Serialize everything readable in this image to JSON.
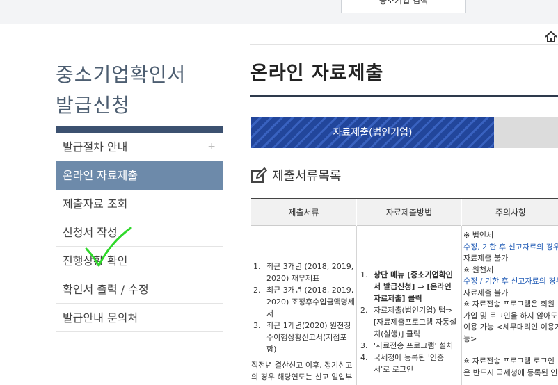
{
  "header": {
    "top_button_label": "중소기업 검색"
  },
  "sidebar": {
    "title_line1": "중소기업확인서",
    "title_line2": "발급신청",
    "items": [
      {
        "label": "발급절차 안내",
        "plus": "+"
      },
      {
        "label": "온라인 자료제출"
      },
      {
        "label": "제출자료 조회"
      },
      {
        "label": "신청서 작성"
      },
      {
        "label": "진행상황 확인"
      },
      {
        "label": "확인서 출력 / 수정"
      },
      {
        "label": "발급안내 문의처"
      }
    ]
  },
  "main": {
    "page_title": "온라인 자료제출",
    "tabs": [
      {
        "label": "자료제출(법인기업)"
      },
      {
        "label": ""
      }
    ],
    "section_title": "제출서류목록",
    "table": {
      "headers": [
        "제출서류",
        "자료제출방법",
        "주의사항"
      ],
      "col1_items": [
        {
          "num": "1.",
          "text": "최근 3개년 (2018, 2019, 2020) 재무제표"
        },
        {
          "num": "2.",
          "text": "최근 3개년 (2018, 2019, 2020) 조정후수입금액명세서"
        },
        {
          "num": "3.",
          "text": "최근 1개년(2020) 원천징수이행상황신고서(지점포함)"
        }
      ],
      "col1_tail": "직전년 결산신고 이후, 정기신고의 경우 해당연도는 신고 일입부",
      "col2_items": [
        {
          "num": "1.",
          "text": "상단 메뉴 [중소기업확인서 발급신청] ⇒ [온라인 자료제출] 클릭"
        },
        {
          "num": "2.",
          "text": "자료제출(법인기업) 탭⇒ [자료제출프로그램 자동설치(실행)] 클릭"
        },
        {
          "num": "3.",
          "text": "'자료전송 프로그램' 설치"
        },
        {
          "num": "4.",
          "text": "국세청에 등록된 '인증서'로 로그인"
        }
      ],
      "col3_lines": [
        {
          "text": "※ 법인세",
          "blue": false
        },
        {
          "text": "수정, 기한 후 신고자료의 경우",
          "blue": true
        },
        {
          "text": "자료제출 불가",
          "blue": false
        },
        {
          "text": "※ 원천세",
          "blue": false
        },
        {
          "text": "수정 / 기한 후 신고자료의 경우",
          "blue": true
        },
        {
          "text": "자료제출 불가",
          "blue": false
        },
        {
          "text": "※ 자료전송 프로그램은 회원",
          "blue": false
        },
        {
          "text": "가입 및 로그인을 하지 않아도",
          "blue": false
        },
        {
          "text": "이용 가능 <세무대리인 이용가",
          "blue": false
        },
        {
          "text": "능>",
          "blue": false
        },
        {
          "text": "",
          "blue": false
        },
        {
          "text": "※ 자료전송 프로그램 로그인",
          "blue": false
        },
        {
          "text": "은 반드시 국세청에 등록된 인",
          "blue": false
        }
      ]
    }
  },
  "colors": {
    "sidebar_active": "#6d8aaa",
    "sidebar_bar": "#3c5170",
    "tab_active": "#22469b",
    "note_blue": "#1f5ab5",
    "annotation_check": "#2fd82a"
  },
  "icons": [
    "home-icon",
    "edit-icon",
    "plus-icon",
    "check-annotation"
  ]
}
